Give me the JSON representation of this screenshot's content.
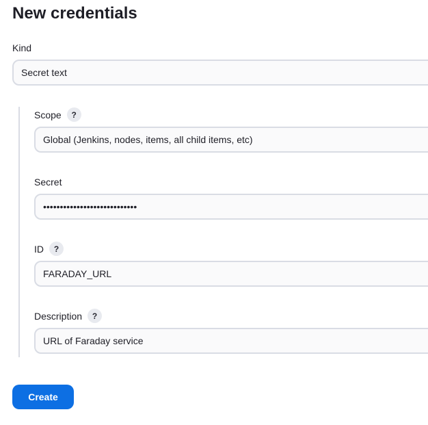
{
  "page": {
    "title": "New credentials"
  },
  "form": {
    "kind": {
      "label": "Kind",
      "value": "Secret text"
    },
    "scope": {
      "label": "Scope",
      "help": "?",
      "value": "Global (Jenkins, nodes, items, all child items, etc)"
    },
    "secret": {
      "label": "Secret",
      "value": "••••••••••••••••••••••••••••"
    },
    "id": {
      "label": "ID",
      "help": "?",
      "value": "FARADAY_URL"
    },
    "description": {
      "label": "Description",
      "help": "?",
      "value": "URL of Faraday service"
    },
    "submit_label": "Create"
  },
  "colors": {
    "primary": "#0d6fe3",
    "input_border": "#d9dce4",
    "input_background": "#fafafb",
    "help_background": "#e8eaef"
  }
}
